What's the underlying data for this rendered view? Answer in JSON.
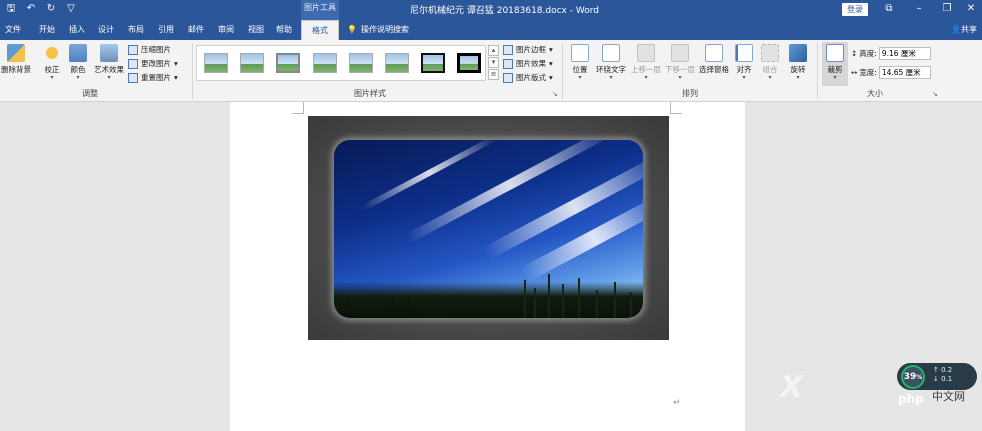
{
  "titlebar": {
    "qat": [
      "save-icon",
      "undo-icon",
      "redo-icon",
      "customize-icon"
    ],
    "contextual_tab": "图片工具",
    "doc_title": "尼尔机械纪元 谭召猛 20183618.docx - Word",
    "login": "登录",
    "window_buttons": [
      "ribbon-display-icon",
      "minimize-icon",
      "restore-icon",
      "close-icon"
    ]
  },
  "tabs": [
    "文件",
    "开始",
    "插入",
    "设计",
    "布局",
    "引用",
    "邮件",
    "审阅",
    "视图",
    "帮助",
    "格式"
  ],
  "tellme": "操作说明搜索",
  "share": "共享",
  "ribbon": {
    "adjust": {
      "remove_bg": "删除背景",
      "corrections": "校正",
      "color": "颜色",
      "artistic": "艺术效果",
      "compress": "压缩图片",
      "change": "更改图片",
      "reset": "重置图片",
      "label": "调整"
    },
    "styles": {
      "border": "图片边框",
      "effects": "图片效果",
      "layout": "图片版式",
      "label": "图片样式"
    },
    "arrange": {
      "position": "位置",
      "wrap": "环绕文字",
      "forward": "上移一层",
      "backward": "下移一层",
      "selection": "选择窗格",
      "align": "对齐",
      "group": "组合",
      "rotate": "旋转",
      "label": "排列"
    },
    "size": {
      "crop": "裁剪",
      "height_label": "高度:",
      "height_value": "9.16 厘米",
      "width_label": "宽度:",
      "width_value": "14.65 厘米",
      "label": "大小"
    }
  },
  "document": {
    "paragraph_mark": "↵"
  },
  "watermark": {
    "speed_pct": "39",
    "speed_unit": "%",
    "rate_up": "0.2",
    "rate_down": "0.1",
    "site": "中文网",
    "brand": "php"
  }
}
